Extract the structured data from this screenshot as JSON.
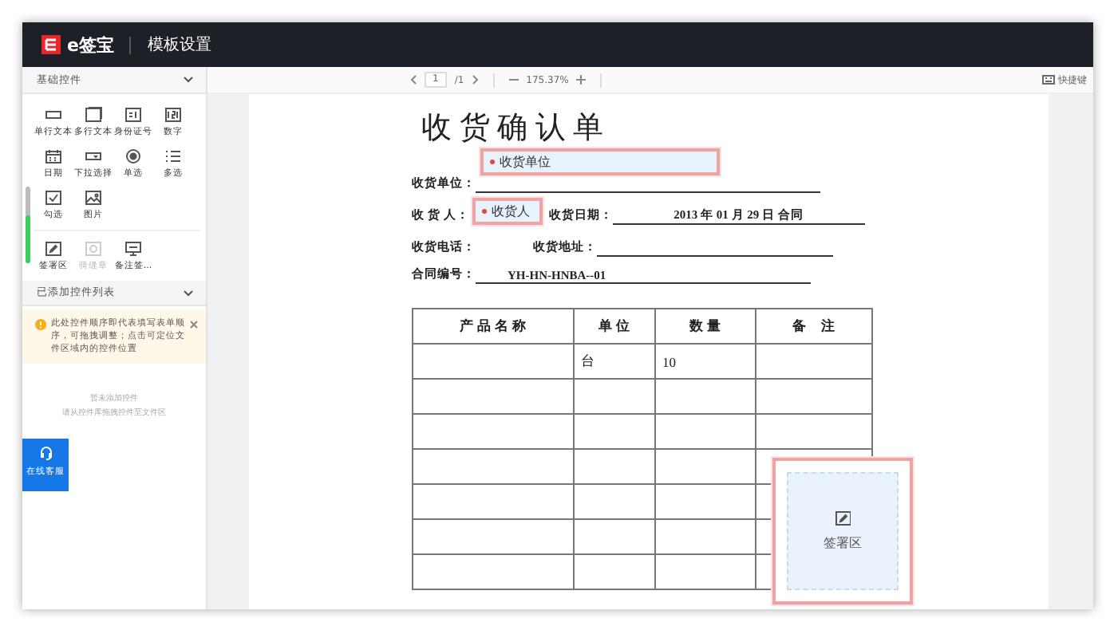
{
  "header": {
    "logo": "e签宝",
    "title": "模板设置"
  },
  "sidebar": {
    "section": "基础控件",
    "controls": [
      {
        "label": "单行文本",
        "kind": "single-text",
        "disabled": false
      },
      {
        "label": "多行文本",
        "kind": "multi-text",
        "disabled": false
      },
      {
        "label": "身份证号",
        "kind": "id",
        "disabled": false
      },
      {
        "label": "数字",
        "kind": "number",
        "disabled": false
      },
      {
        "label": "日期",
        "kind": "date",
        "disabled": false
      },
      {
        "label": "下拉选择",
        "kind": "select",
        "disabled": false
      },
      {
        "label": "单选",
        "kind": "radio",
        "disabled": false
      },
      {
        "label": "多选",
        "kind": "multi",
        "disabled": false
      },
      {
        "label": "勾选",
        "kind": "check",
        "disabled": false
      },
      {
        "label": "图片",
        "kind": "image",
        "disabled": false
      }
    ],
    "sign_controls": [
      {
        "label": "签署区",
        "kind": "sign",
        "disabled": false
      },
      {
        "label": "骑缝章",
        "kind": "seal",
        "disabled": true
      },
      {
        "label": "备注签...",
        "kind": "note",
        "disabled": false
      }
    ],
    "added_section": "已添加控件列表",
    "notice": "此处控件顺序即代表填写表单顺序，可拖拽调整；点击可定位文件区域内的控件位置",
    "empty": [
      "暂未添加控件",
      "请从控件库拖拽控件至文件区"
    ]
  },
  "support_button": "在线客服",
  "toolbar": {
    "page": "1",
    "pages": "/1",
    "zoom": "175.37%",
    "shortcuts": "快捷键"
  },
  "document": {
    "title": "收 货 确 认 单",
    "lines": [
      {
        "kind": "field",
        "label": "收货单位：",
        "field": {
          "label": "收货单位",
          "required": true
        }
      },
      {
        "kind": "pair",
        "label": "收 货 人：",
        "field": {
          "label": "收货人",
          "required": true
        },
        "label_2": "收货日期：",
        "value_2": "2013 年 01 月 29 日  合同"
      },
      {
        "kind": "pair",
        "label": "收货电话：",
        "label_2": "收货地址："
      },
      {
        "kind": "value",
        "label": "合同编号：",
        "value": "YH-HN-HNBA--01"
      }
    ],
    "table": {
      "columns": [
        "产 品 名 称",
        "单 位",
        "数 量",
        "备　注"
      ],
      "rows": [
        [
          null,
          "台",
          "10",
          null
        ],
        [
          null,
          null,
          null,
          null
        ],
        [
          null,
          null,
          null,
          null
        ],
        [
          null,
          null,
          null,
          null
        ],
        [
          null,
          null,
          null,
          null
        ],
        [
          null,
          null,
          null,
          null
        ],
        [
          null,
          null,
          null,
          null
        ]
      ]
    },
    "signature_area": "签署区"
  }
}
